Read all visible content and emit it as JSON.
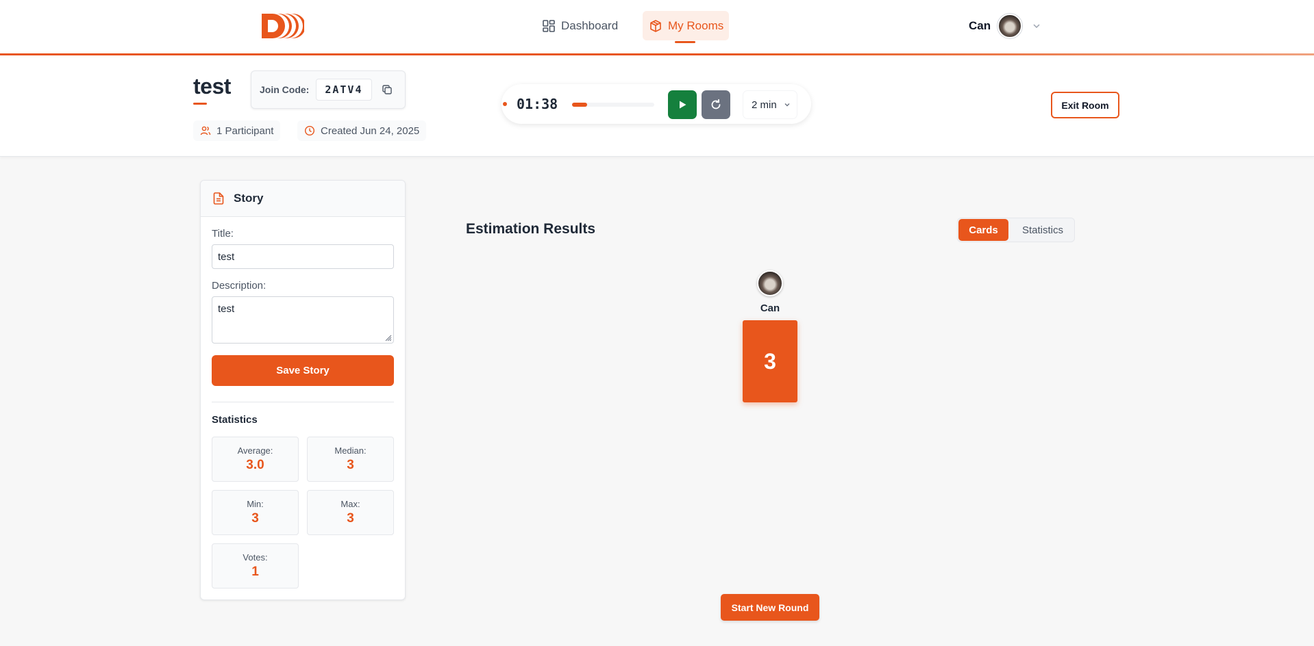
{
  "nav": {
    "dashboard_label": "Dashboard",
    "my_rooms_label": "My Rooms",
    "user_name": "Can",
    "active_tab": "My Rooms"
  },
  "colors": {
    "accent": "#e8561c",
    "play_button": "#15803d",
    "reset_button": "#6b7280"
  },
  "icons": [
    "logo-icon",
    "dashboard-icon",
    "box-icon",
    "chevron-down-icon",
    "copy-icon",
    "users-icon",
    "clock-icon",
    "play-icon",
    "refresh-icon",
    "file-text-icon"
  ],
  "room": {
    "title": "test",
    "join_code_label": "Join Code:",
    "join_code": "2ATV4",
    "participants": "1 Participant",
    "created": "Created Jun 24, 2025",
    "exit_label": "Exit Room"
  },
  "timer": {
    "time": "01:38",
    "progress": 0.18,
    "duration": "2 min"
  },
  "story": {
    "header": "Story",
    "title_label": "Title:",
    "title_value": "test",
    "description_label": "Description:",
    "description_value": "test",
    "save_label": "Save Story"
  },
  "statistics": {
    "header": "Statistics",
    "average_label": "Average:",
    "average": "3.0",
    "median_label": "Median:",
    "median": "3",
    "min_label": "Min:",
    "min": "3",
    "max_label": "Max:",
    "max": "3",
    "votes_label": "Votes:",
    "votes": "1"
  },
  "results": {
    "title": "Estimation Results",
    "view_cards": "Cards",
    "view_statistics": "Statistics",
    "active_view": "Cards",
    "votes": [
      {
        "name": "Can",
        "value": "3"
      }
    ],
    "new_round_label": "Start New Round"
  }
}
